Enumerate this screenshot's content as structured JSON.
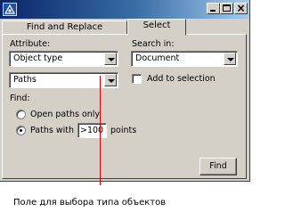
{
  "tabs": [
    {
      "label": "Find and Replace",
      "active": false
    },
    {
      "label": "Select",
      "active": true
    }
  ],
  "attribute": {
    "label": "Attribute:",
    "value": "Object type",
    "subtype_value": "Paths"
  },
  "search_in": {
    "label": "Search in:",
    "value": "Document"
  },
  "add_to_selection": {
    "label": "Add to selection",
    "checked": false
  },
  "find": {
    "label": "Find:",
    "options": [
      {
        "label": "Open paths only",
        "checked": false
      },
      {
        "label": "Paths with",
        "checked": true
      }
    ],
    "comparison_value": ">100",
    "unit": "points"
  },
  "find_button": {
    "label": "Find"
  },
  "caption": "Поле для выбора типа объектов",
  "colors": {
    "callout_line": "#e00000",
    "titlebar": "#0a246a"
  }
}
